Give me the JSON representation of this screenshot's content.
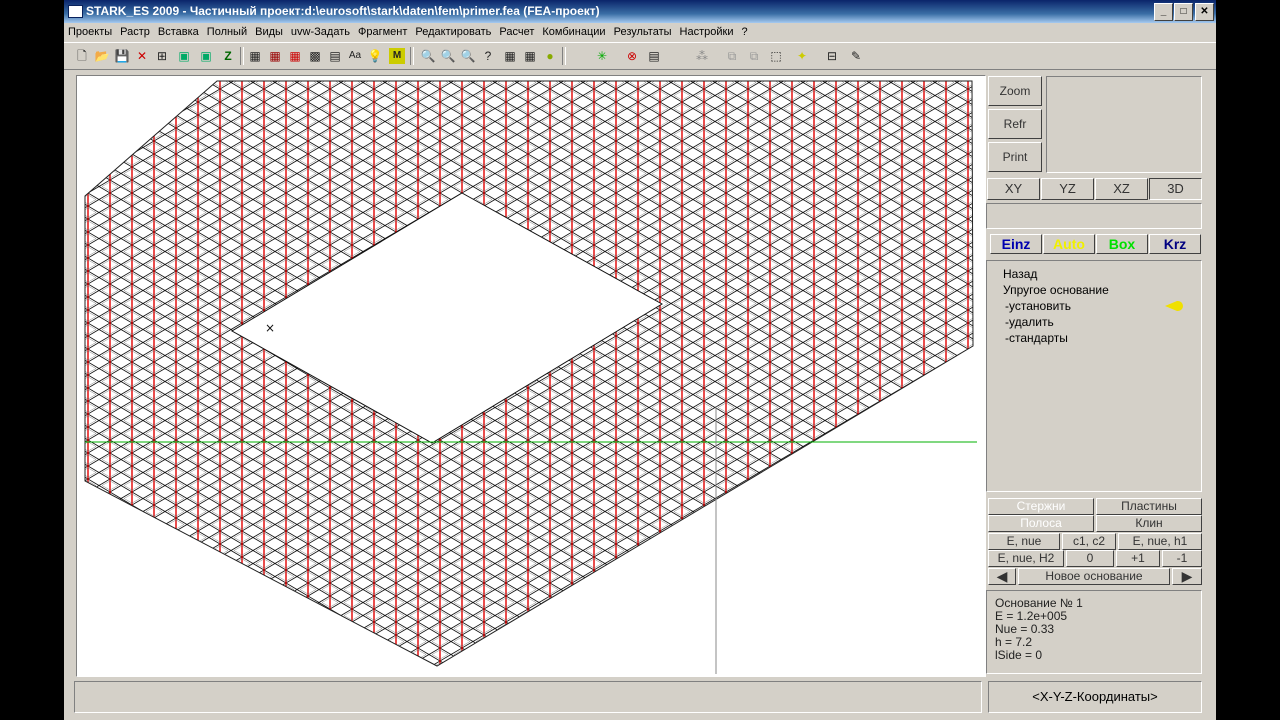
{
  "window": {
    "title": "STARK_ES 2009 - Частичный проект:d:\\eurosoft\\stark\\daten\\fem\\primer.fea  (FEA-проект)"
  },
  "menu": [
    "Проекты",
    "Растр",
    "Вставка",
    "Полный",
    "Виды",
    "uvw-Задать",
    "Фрагмент",
    "Редактировать",
    "Расчет",
    "Комбинации",
    "Результаты",
    "Настройки",
    "?"
  ],
  "toolbar": {
    "icons": [
      "new-icon",
      "open-icon",
      "save-icon",
      "cut-icon",
      "node-icon",
      "monitor-icon",
      "monitor-alt-icon",
      "z-icon",
      "grid-icon",
      "grid-alt-icon",
      "grid-red-icon",
      "grid-dark-icon",
      "grid-ab-icon",
      "label-icon",
      "lamp-icon",
      "m-icon",
      "zoom-icon",
      "zoom-in-icon",
      "zoom-out-icon",
      "help-icon",
      "axis-icon",
      "cancel-icon",
      "select-icon",
      "random-icon",
      "cube-icon",
      "bulb-icon",
      "frame-icon",
      "draw-icon"
    ]
  },
  "right_panel": {
    "zoom_label": "Zoom",
    "refr_label": "Refr",
    "print_label": "Print",
    "views": [
      "XY",
      "YZ",
      "XZ",
      "3D"
    ],
    "modes": [
      {
        "label": "Einz",
        "color": "#0000b0"
      },
      {
        "label": "Auto",
        "color": "#f0f000"
      },
      {
        "label": "Box",
        "color": "#00e000"
      },
      {
        "label": "Krz",
        "color": "#000080"
      }
    ],
    "menu_items": [
      "Назад",
      "Упругое основание",
      "-установить",
      "-удалить",
      "-стандарты"
    ],
    "arrow_color": "#f0e000",
    "type_buttons": [
      "Стержни",
      "Пластины",
      "Полоса",
      "Клин"
    ],
    "param_buttons": [
      "E, nue",
      "c1, c2",
      "E, nue, h1",
      "E, nue, H2",
      "0",
      "+1",
      "-1"
    ],
    "new_base_label": "Новое основание",
    "info_lines": [
      "Основание № 1",
      "E      = 1.2e+005",
      "Nue  = 0.33",
      "h      = 7.2",
      "lSide = 0"
    ],
    "status_right": "<X-Y-Z-Координаты>"
  },
  "colors": {
    "title_bar": "#0a246a",
    "mesh_line": "#111111",
    "spring": "#e00000",
    "axis": "#00b000"
  }
}
